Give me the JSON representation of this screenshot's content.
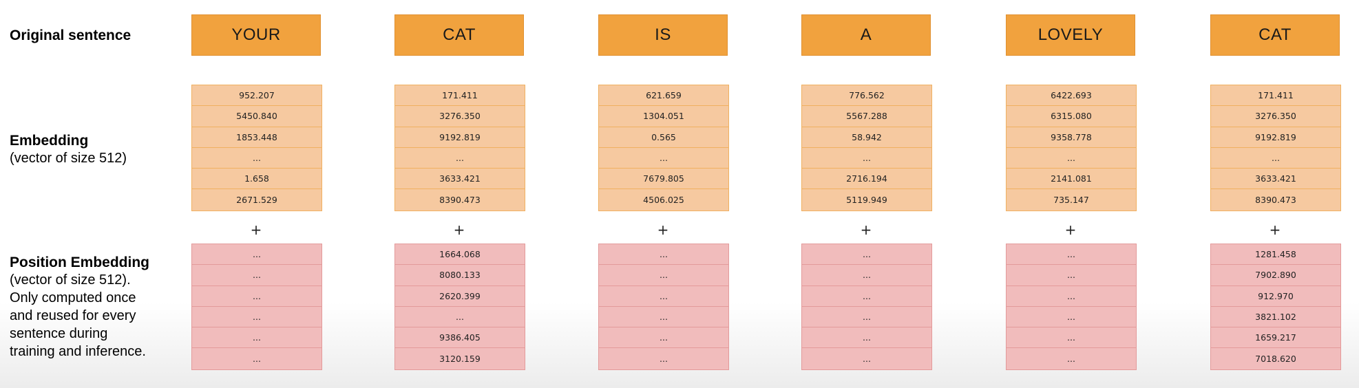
{
  "labels": {
    "original_title": "Original sentence",
    "embedding_title": "Embedding",
    "embedding_sub": "(vector of size 512)",
    "position_title": "Position Embedding",
    "position_sub_lines": [
      "(vector of size 512).",
      "Only computed once",
      "and reused for every",
      "sentence during",
      "training and inference."
    ]
  },
  "plus_symbol": "+",
  "colors": {
    "word_bg": "#f1a23e",
    "embedding_bg": "#f6c9a0",
    "position_bg": "#f1bcbc"
  },
  "columns": [
    {
      "word": "YOUR",
      "embedding": [
        "952.207",
        "5450.840",
        "1853.448",
        "...",
        "1.658",
        "2671.529"
      ],
      "position": [
        "...",
        "...",
        "...",
        "...",
        "...",
        "..."
      ]
    },
    {
      "word": "CAT",
      "embedding": [
        "171.411",
        "3276.350",
        "9192.819",
        "...",
        "3633.421",
        "8390.473"
      ],
      "position": [
        "1664.068",
        "8080.133",
        "2620.399",
        "...",
        "9386.405",
        "3120.159"
      ]
    },
    {
      "word": "IS",
      "embedding": [
        "621.659",
        "1304.051",
        "0.565",
        "...",
        "7679.805",
        "4506.025"
      ],
      "position": [
        "...",
        "...",
        "...",
        "...",
        "...",
        "..."
      ]
    },
    {
      "word": "A",
      "embedding": [
        "776.562",
        "5567.288",
        "58.942",
        "...",
        "2716.194",
        "5119.949"
      ],
      "position": [
        "...",
        "...",
        "...",
        "...",
        "...",
        "..."
      ]
    },
    {
      "word": "LOVELY",
      "embedding": [
        "6422.693",
        "6315.080",
        "9358.778",
        "...",
        "2141.081",
        "735.147"
      ],
      "position": [
        "...",
        "...",
        "...",
        "...",
        "...",
        "..."
      ]
    },
    {
      "word": "CAT",
      "embedding": [
        "171.411",
        "3276.350",
        "9192.819",
        "...",
        "3633.421",
        "8390.473"
      ],
      "position": [
        "1281.458",
        "7902.890",
        "912.970",
        "3821.102",
        "1659.217",
        "7018.620"
      ]
    }
  ]
}
